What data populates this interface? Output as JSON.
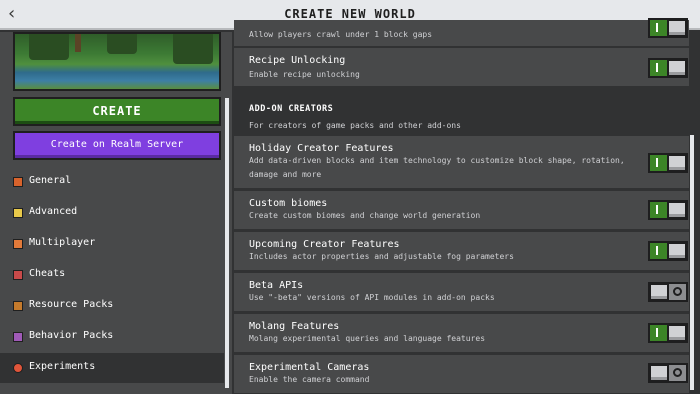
{
  "header": {
    "title": "CREATE NEW WORLD",
    "back_icon": "‹"
  },
  "sidebar": {
    "create_label": "CREATE",
    "realm_label": "Create on Realm Server",
    "items": [
      {
        "label": "General",
        "icon": "general-icon",
        "color": "#d8632c"
      },
      {
        "label": "Advanced",
        "icon": "advanced-icon",
        "color": "#e8c94a"
      },
      {
        "label": "Multiplayer",
        "icon": "multiplayer-icon",
        "color": "#e27a3a"
      },
      {
        "label": "Cheats",
        "icon": "cheats-icon",
        "color": "#c94a4a"
      },
      {
        "label": "Resource Packs",
        "icon": "resource-packs-icon",
        "color": "#c47a2c"
      },
      {
        "label": "Behavior Packs",
        "icon": "behavior-packs-icon",
        "color": "#a05ab8"
      },
      {
        "label": "Experiments",
        "icon": "experiments-icon",
        "color": "#e0553a",
        "selected": true
      }
    ]
  },
  "main": {
    "partial_row_desc": "Allow players crawl under 1 block gaps",
    "recipe": {
      "title": "Recipe Unlocking",
      "desc": "Enable recipe unlocking",
      "on": true
    },
    "addon_section": {
      "title": "ADD-ON CREATORS",
      "desc": "For creators of game packs and other add-ons"
    },
    "rows": [
      {
        "title": "Holiday Creator Features",
        "desc": "Add data-driven blocks and item technology to customize block shape, rotation, damage and more",
        "on": true
      },
      {
        "title": "Custom biomes",
        "desc": "Create custom biomes and change world generation",
        "on": true
      },
      {
        "title": "Upcoming Creator Features",
        "desc": "Includes actor properties and adjustable fog parameters",
        "on": true
      },
      {
        "title": "Beta APIs",
        "desc": "Use \"-beta\" versions of API modules in add-on packs",
        "on": false
      },
      {
        "title": "Molang Features",
        "desc": "Molang experimental queries and language features",
        "on": true
      },
      {
        "title": "Experimental Cameras",
        "desc": "Enable the camera command",
        "on": false
      }
    ]
  },
  "colors": {
    "toggle_on": "#3c8527",
    "toggle_off": "#8c8d90",
    "create": "#3c8527",
    "realm": "#7f3fe0"
  }
}
